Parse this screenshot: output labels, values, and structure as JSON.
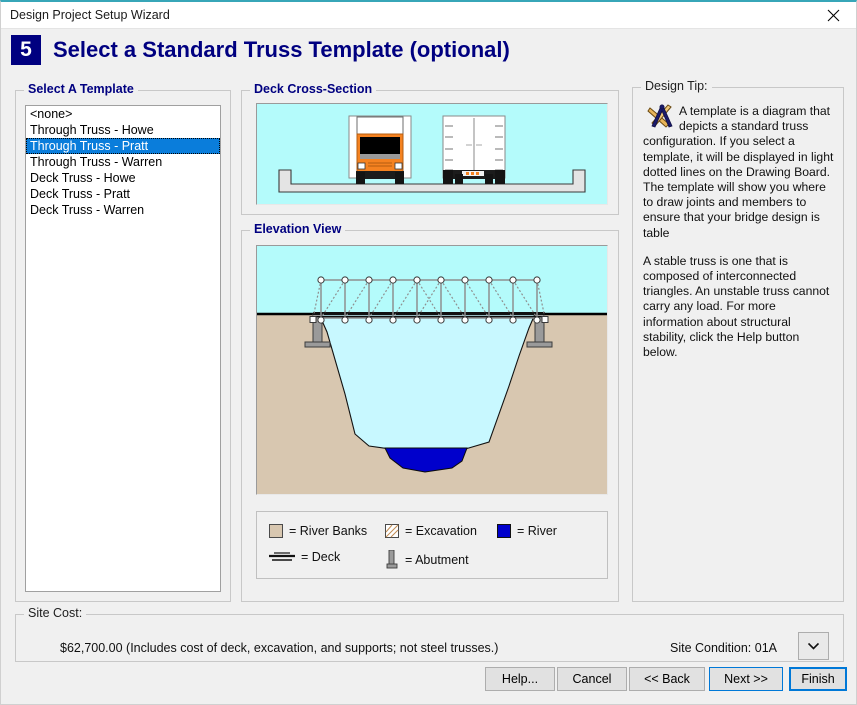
{
  "window": {
    "title": "Design Project Setup Wizard",
    "close_icon": "close-icon"
  },
  "header": {
    "step_number": "5",
    "title": "Select a Standard Truss Template (optional)"
  },
  "template_panel": {
    "label": "Select A Template",
    "items": [
      {
        "label": "<none>",
        "selected": false
      },
      {
        "label": "Through Truss - Howe",
        "selected": false
      },
      {
        "label": "Through Truss - Pratt",
        "selected": true
      },
      {
        "label": "Through Truss - Warren",
        "selected": false
      },
      {
        "label": "Deck Truss - Howe",
        "selected": false
      },
      {
        "label": "Deck Truss - Pratt",
        "selected": false
      },
      {
        "label": "Deck Truss - Warren",
        "selected": false
      }
    ]
  },
  "deck_cross_section": {
    "label": "Deck Cross-Section"
  },
  "elevation_view": {
    "label": "Elevation View"
  },
  "legend": {
    "items": [
      {
        "swatch": "river-banks-swatch",
        "text": "= River Banks"
      },
      {
        "swatch": "excavation-swatch",
        "text": "= Excavation"
      },
      {
        "swatch": "river-swatch",
        "text": "= River"
      },
      {
        "swatch": "deck-swatch",
        "text": "= Deck"
      },
      {
        "swatch": "abutment-swatch",
        "text": "= Abutment"
      }
    ]
  },
  "design_tip": {
    "label": "Design Tip:",
    "icon": "drafting-square-compass-icon",
    "paragraph1": "A template is a diagram that depicts a standard truss configuration. If you select a template, it will be displayed in light dotted lines on the Drawing Board. The template will show you where to draw joints and members to ensure that your bridge design is table",
    "paragraph2": "A stable truss is one that is composed of interconnected triangles. An unstable truss cannot carry any load. For more information about structural stability, click the Help button below."
  },
  "site_cost": {
    "label": "Site Cost:",
    "amount_line": "$62,700.00  (Includes cost of deck, excavation, and supports; not steel trusses.)",
    "site_condition": "Site Condition: 01A",
    "dropdown_icon": "chevron-down-icon"
  },
  "buttons": {
    "help": "Help...",
    "cancel": "Cancel",
    "back": "<< Back",
    "next": "Next >>",
    "finish": "Finish"
  },
  "colors": {
    "accent_top": "#37a6b8",
    "title_navy": "#000080",
    "selection_blue": "#0a7ddb",
    "sky": "#b4fbfb",
    "ground": "#d8c7b0",
    "river": "#0000cc",
    "excavation": "#c8f8ff",
    "focus_blue": "#0078d7",
    "truck_orange": "#f58220"
  }
}
